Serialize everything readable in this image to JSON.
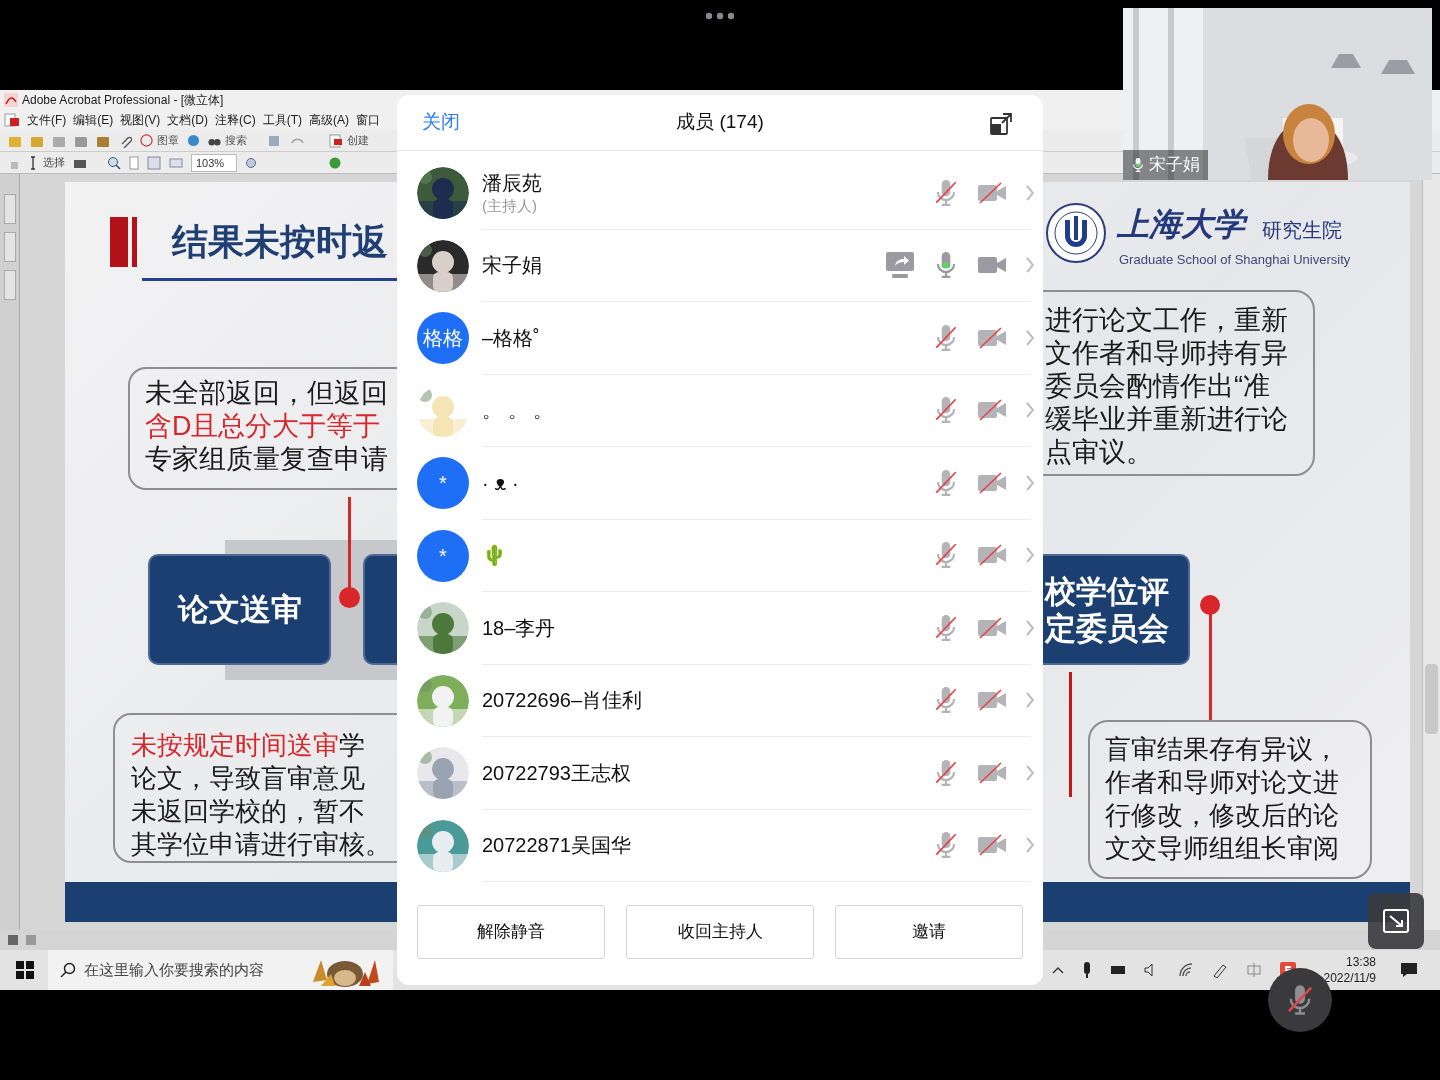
{
  "shared_screen": {
    "acrobat": {
      "title": "Adobe Acrobat Professional - [微立体]",
      "menus": [
        "文件(F)",
        "编辑(E)",
        "视图(V)",
        "文档(D)",
        "注释(C)",
        "工具(T)",
        "高级(A)",
        "窗口"
      ],
      "toolbar_texts": [
        "图章",
        "搜索",
        "创建"
      ],
      "select_tool": "选择",
      "zoom": "103%"
    },
    "slide": {
      "title": "结果未按时返",
      "logo": {
        "name": "上海大学",
        "dept": "研究生院",
        "english": "Graduate School of Shanghai University"
      },
      "left_note_1": [
        [
          {
            "text": "未全部返回，但返回",
            "highlight": false
          }
        ],
        [
          {
            "text": "含D且总分大于等于",
            "highlight": true
          }
        ],
        [
          {
            "text": "专家组质量复查申请",
            "highlight": false
          }
        ]
      ],
      "left_note_2": [
        [
          {
            "text": "未按规定时间送审",
            "highlight": true
          },
          {
            "text": "学",
            "highlight": false
          }
        ],
        [
          {
            "text": "论文，导致盲审意见",
            "highlight": false
          }
        ],
        [
          {
            "text": "未返回学校的，暂不",
            "highlight": false
          }
        ],
        [
          {
            "text": "其学位申请进行审核。",
            "highlight": false
          }
        ]
      ],
      "right_note_1": [
        [
          {
            "text": "进行论文工作，重新",
            "highlight": false
          }
        ],
        [
          {
            "text": "文作者和导师持有异",
            "highlight": false
          }
        ],
        [
          {
            "text": "委员会酌情作出“准",
            "highlight": false
          }
        ],
        [
          {
            "text": "缓毕业并重新进行论",
            "highlight": false
          }
        ],
        [
          {
            "text": "点审议。",
            "highlight": false
          }
        ]
      ],
      "right_note_2": [
        [
          {
            "text": "盲审结果存有异议，",
            "highlight": false
          }
        ],
        [
          {
            "text": "作者和导师对论文进",
            "highlight": false
          }
        ],
        [
          {
            "text": "行修改，修改后的论",
            "highlight": false
          }
        ],
        [
          {
            "text": "文交导师组组长审阅",
            "highlight": false
          }
        ]
      ],
      "step_left": [
        "论文送审"
      ],
      "step_right": [
        "校学位评",
        "定委员会"
      ]
    },
    "taskbar": {
      "search_placeholder": "在这里输入你要搜索的内容",
      "time": "13:38",
      "date": "2022/11/9"
    }
  },
  "video_tile": {
    "name": "宋子娟"
  },
  "members_panel": {
    "close": "关闭",
    "title": "成员 (174)",
    "members": [
      {
        "name": "潘辰苑",
        "role": "(主持人)",
        "sharing": false,
        "mic_muted": true,
        "video_off": true
      },
      {
        "name": "宋子娟",
        "sharing": true,
        "mic_muted": false,
        "video_off": false
      },
      {
        "name": "–格格˚",
        "avatar": {
          "kind": "text",
          "text": "格格"
        },
        "sharing": false,
        "mic_muted": true,
        "video_off": true
      },
      {
        "name": "。 。 。",
        "sharing": false,
        "mic_muted": true,
        "video_off": true
      },
      {
        "name": "· ᴥ ·",
        "avatar": {
          "kind": "text",
          "text": "*"
        },
        "sharing": false,
        "mic_muted": true,
        "video_off": true
      },
      {
        "name": "🌵",
        "avatar": {
          "kind": "text",
          "text": "*"
        },
        "sharing": false,
        "mic_muted": true,
        "video_off": true
      },
      {
        "name": "18–李丹",
        "sharing": false,
        "mic_muted": true,
        "video_off": true
      },
      {
        "name": "20722696–肖佳利",
        "sharing": false,
        "mic_muted": true,
        "video_off": true
      },
      {
        "name": "20722793王志权",
        "sharing": false,
        "mic_muted": true,
        "video_off": true
      },
      {
        "name": "20722871吴国华",
        "sharing": false,
        "mic_muted": true,
        "video_off": true
      }
    ],
    "buttons": [
      "解除静音",
      "收回主持人",
      "邀请"
    ]
  }
}
